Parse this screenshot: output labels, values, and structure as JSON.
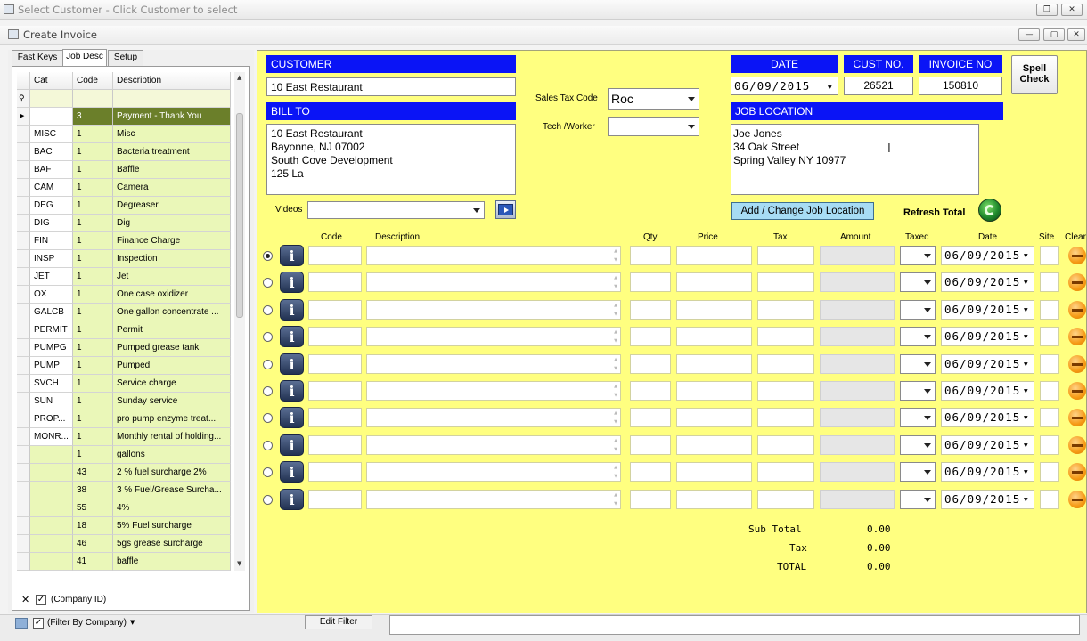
{
  "outer_window": {
    "title": "Select Customer - Click Customer to select"
  },
  "inner_window": {
    "title": "Create Invoice"
  },
  "left": {
    "tabs": [
      "Fast Keys",
      "Job Desc",
      "Setup"
    ],
    "active_tab": 1,
    "columns": [
      "Cat",
      "Code",
      "Description"
    ],
    "rows": [
      {
        "cat": "",
        "code": "3",
        "desc": "Payment - Thank You"
      },
      {
        "cat": "MISC",
        "code": "1",
        "desc": "Misc"
      },
      {
        "cat": "BAC",
        "code": "1",
        "desc": "Bacteria treatment"
      },
      {
        "cat": "BAF",
        "code": "1",
        "desc": "Baffle"
      },
      {
        "cat": "CAM",
        "code": "1",
        "desc": "Camera"
      },
      {
        "cat": "DEG",
        "code": "1",
        "desc": "Degreaser"
      },
      {
        "cat": "DIG",
        "code": "1",
        "desc": "Dig"
      },
      {
        "cat": "FIN",
        "code": "1",
        "desc": "Finance Charge"
      },
      {
        "cat": "INSP",
        "code": "1",
        "desc": "Inspection"
      },
      {
        "cat": "JET",
        "code": "1",
        "desc": "Jet"
      },
      {
        "cat": "OX",
        "code": "1",
        "desc": "One case oxidizer"
      },
      {
        "cat": "GALCB",
        "code": "1",
        "desc": "One gallon concentrate ..."
      },
      {
        "cat": "PERMIT",
        "code": "1",
        "desc": "Permit"
      },
      {
        "cat": "PUMPG",
        "code": "1",
        "desc": "Pumped grease tank"
      },
      {
        "cat": "PUMP",
        "code": "1",
        "desc": "Pumped"
      },
      {
        "cat": "SVCH",
        "code": "1",
        "desc": "Service charge"
      },
      {
        "cat": "SUN",
        "code": "1",
        "desc": "Sunday service"
      },
      {
        "cat": "PROP...",
        "code": "1",
        "desc": "pro pump enzyme treat..."
      },
      {
        "cat": "MONR...",
        "code": "1",
        "desc": "Monthly rental of holding..."
      },
      {
        "cat": "",
        "code": "1",
        "desc": "gallons"
      },
      {
        "cat": "",
        "code": "43",
        "desc": "2 % fuel surcharge 2%"
      },
      {
        "cat": "",
        "code": "38",
        "desc": "3 % Fuel/Grease Surcha..."
      },
      {
        "cat": "",
        "code": "55",
        "desc": "4%"
      },
      {
        "cat": "",
        "code": "18",
        "desc": "5% Fuel surcharge"
      },
      {
        "cat": "",
        "code": "46",
        "desc": "5gs grease surcharge"
      },
      {
        "cat": "",
        "code": "41",
        "desc": "baffle"
      }
    ],
    "company_filter_label": "(Company ID)"
  },
  "bottom_bar": {
    "filter_label": "(Filter By Company)",
    "edit_filter_label": "Edit Filter"
  },
  "invoice": {
    "customer_header": "CUSTOMER",
    "customer_name": "10 East Restaurant",
    "bill_to_header": "BILL TO",
    "bill_to_lines": [
      "10 East Restaurant",
      "Bayonne, NJ 07002",
      "South Cove Development",
      "125 La"
    ],
    "sales_tax_label": "Sales Tax Code",
    "sales_tax_value": "Roc",
    "tech_label": "Tech /Worker",
    "tech_value": "",
    "videos_label": "Videos",
    "date_header": "DATE",
    "date_value": "06/09/2015",
    "cust_no_header": "CUST NO.",
    "cust_no_value": "26521",
    "invoice_no_header": "INVOICE NO",
    "invoice_no_value": "150810",
    "spell_check_label": "Spell\nCheck",
    "job_location_header": "JOB LOCATION",
    "job_location_lines": [
      "Joe Jones",
      "34 Oak Street",
      "Spring Valley NY 10977"
    ],
    "change_location_label": "Add / Change Job Location",
    "refresh_total_label": "Refresh Total",
    "line_columns": {
      "code": "Code",
      "description": "Description",
      "qty": "Qty",
      "price": "Price",
      "tax": "Tax",
      "amount": "Amount",
      "taxed": "Taxed",
      "date": "Date",
      "site": "Site",
      "clear": "Clear"
    },
    "line_dates": [
      "06/09/2015",
      "06/09/2015",
      "06/09/2015",
      "06/09/2015",
      "06/09/2015",
      "06/09/2015",
      "06/09/2015",
      "06/09/2015",
      "06/09/2015",
      "06/09/2015"
    ],
    "info_icon_glyph": "i",
    "totals": {
      "sub_total_label": "Sub Total",
      "sub_total_value": "0.00",
      "tax_label": "Tax",
      "tax_value": "0.00",
      "total_label": "TOTAL",
      "total_value": "0.00"
    }
  },
  "colors": {
    "panel_yellow": "#ffff80",
    "header_blue": "#0a14f6",
    "row_green": "#eaf7b8",
    "row_selected": "#6b7f2a"
  }
}
